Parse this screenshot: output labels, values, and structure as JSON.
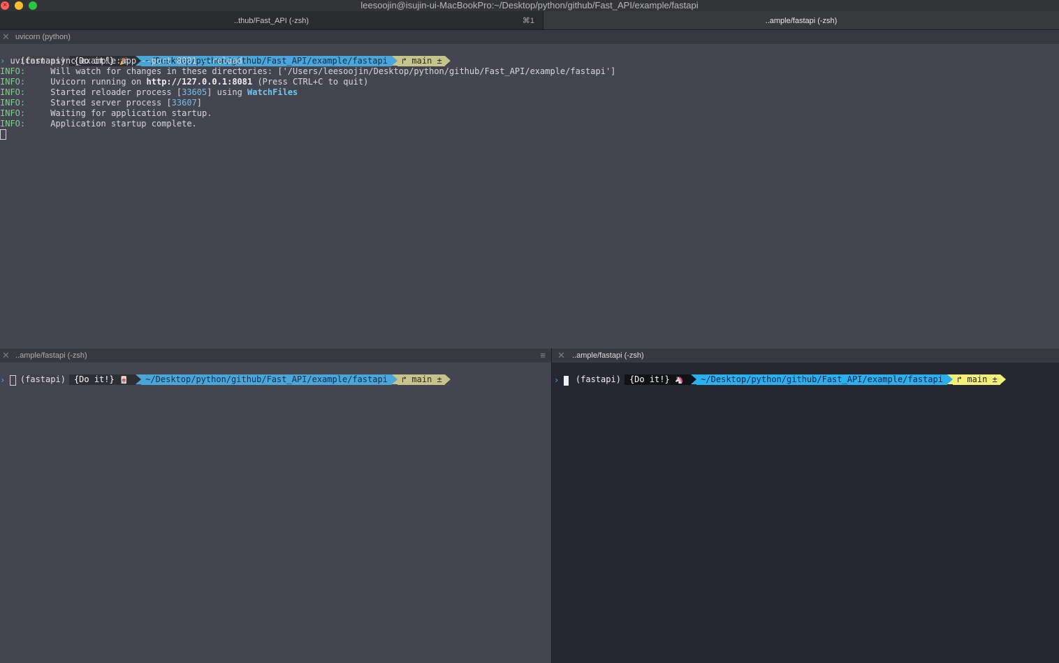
{
  "window": {
    "title": "leesoojin@isujin-ui-MacBookPro:~/Desktop/python/github/Fast_API/example/fastapi",
    "traffic_lights": [
      "close",
      "minimize",
      "zoom"
    ]
  },
  "tabs": [
    {
      "label": "..thub/Fast_API (-zsh)",
      "shortcut": "⌘1",
      "active": false
    },
    {
      "label": "..ample/fastapi (-zsh)",
      "active": true
    }
  ],
  "panes": {
    "top": {
      "header": "uvicorn (python)",
      "prompt": {
        "env": "(fastapi)",
        "badge": "{Do it!}",
        "emoji": "🎉",
        "path": "~/Desktop/python/github/Fast_API/example/fastapi",
        "git": "↱ main ±"
      },
      "command": " uvicorn async_example:app --port 8081 --reload",
      "log": [
        {
          "level": "INFO:",
          "pre": "     Will watch for changes in these directories: ['/Users/leesoojin/Desktop/python/github/Fast_API/example/fastapi']"
        },
        {
          "level": "INFO:",
          "pre": "     Uvicorn running on ",
          "bold": "http://127.0.0.1:8081",
          "post": " (Press CTRL+C to quit)"
        },
        {
          "level": "INFO:",
          "pre": "     Started reloader process [",
          "num": "33605",
          "mid": "] using ",
          "tool": "WatchFiles"
        },
        {
          "level": "INFO:",
          "pre": "     Started server process [",
          "num": "33607",
          "mid": "]"
        },
        {
          "level": "INFO:",
          "pre": "     Waiting for application startup."
        },
        {
          "level": "INFO:",
          "pre": "     Application startup complete."
        }
      ]
    },
    "bottom_left": {
      "header": "..ample/fastapi (-zsh)",
      "prompt": {
        "env": "(fastapi)",
        "badge": "{Do it!}",
        "emoji": "🀄",
        "path": "~/Desktop/python/github/Fast_API/example/fastapi",
        "git": "↱ main ±"
      }
    },
    "bottom_right": {
      "header": "..ample/fastapi (-zsh)",
      "prompt": {
        "env": "(fastapi)",
        "badge": "{Do it!}",
        "emoji": "🦄",
        "path": "~/Desktop/python/github/Fast_API/example/fastapi",
        "git": "↱ main ±"
      }
    }
  },
  "colors": {
    "info": "#7fd08e",
    "path_segment": "#4aa5d9",
    "git_segment": "#c6c48a",
    "active_path_segment": "#2ab0ef",
    "active_git_segment": "#f2f07a"
  }
}
